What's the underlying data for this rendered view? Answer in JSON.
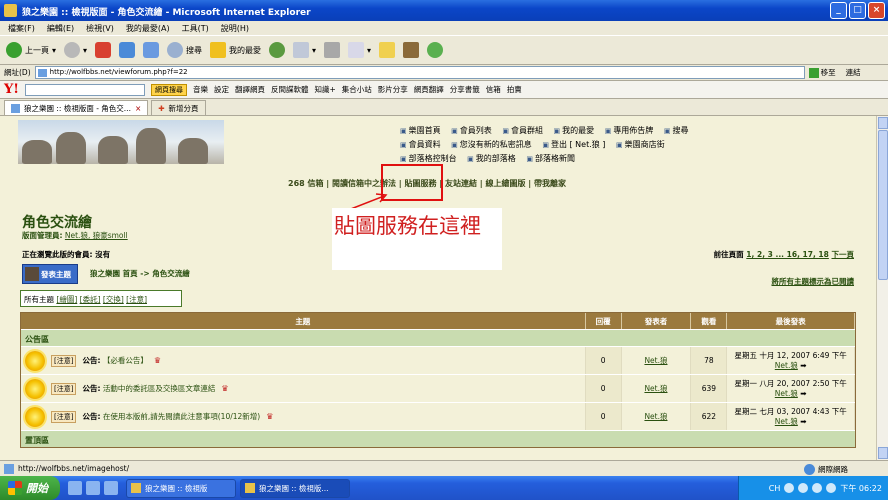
{
  "window": {
    "title": "狼之樂園 :: 檢視版面 - 角色交流繪 - Microsoft Internet Explorer",
    "min": "_",
    "max": "□",
    "close": "×"
  },
  "menu": [
    "檔案(F)",
    "編輯(E)",
    "檢視(V)",
    "我的最愛(A)",
    "工具(T)",
    "說明(H)"
  ],
  "toolbar": {
    "back": "上一頁",
    "search": "搜尋",
    "favorites": "我的最愛"
  },
  "address": {
    "label": "網址(D)",
    "url": "http://wolfbbs.net/viewforum.php?f=22",
    "go": "移至",
    "links": "連結"
  },
  "yahoo": {
    "logo": "Y!",
    "search_btn": "網頁搜尋",
    "items": [
      "音樂",
      "設定",
      "翻譯網頁",
      "反間諜軟體",
      "知識+",
      "集合小站",
      "影片分享",
      "網頁翻譯",
      "分享書籤",
      "信箱",
      "拍賣"
    ]
  },
  "tabs": [
    {
      "label": "狼之樂園 :: 檢視版面 - 角色交..."
    },
    {
      "label": "新增分頁"
    }
  ],
  "site": {
    "toplinks": [
      "樂園首頁",
      "會員列表",
      "會員群組",
      "我的最愛",
      "專用佈告牌",
      "搜尋",
      "會員資料",
      "您沒有新的私密訊息",
      "登出 [ Net.狼 ]",
      "樂園商店街",
      "部落格控制台",
      "我的部落格",
      "部落格新聞"
    ],
    "nav": "268 信箱 | 閱讀信箱中之辦法 | 貼圖服務 | 友站連結 | 線上繪圖版 | 帶我離家",
    "annotation": "貼圖服務在這裡",
    "forum_title": "角色交流繪",
    "moderators_label": "版面管理員:",
    "moderators": "Net.狼, 狼豪smoll",
    "browsing": "正在瀏覽此版的會員: 沒有",
    "pager_label": "前往頁面",
    "pager_pages": "1, 2, 3 ... 16, 17, 18",
    "pager_next": "下一頁",
    "new_topic": "發表主題",
    "crumbs": "狼之樂園 首頁 -> 角色交流繪",
    "mark_read": "將所有主題標示為已閱讀",
    "filter_all": "所有主題",
    "filters": [
      "[繪圖]",
      "[委託]",
      "[交換]",
      "[注意]"
    ]
  },
  "table": {
    "headers": [
      "主題",
      "回覆",
      "發表者",
      "觀看",
      "最後發表"
    ],
    "section1": "公告區",
    "section2": "置頂區",
    "rows": [
      {
        "tag": "[注意]",
        "prefix": "公告:",
        "title": "【必看公告】",
        "replies": "0",
        "author": "Net.狼",
        "views": "78",
        "last_date": "星期五 十月 12, 2007 6:49 下午",
        "last_by": "Net.狼"
      },
      {
        "tag": "[注意]",
        "prefix": "公告:",
        "title": "活動中的委託區及交換區文章連結",
        "replies": "0",
        "author": "Net.狼",
        "views": "639",
        "last_date": "星期一 八月 20, 2007 2:50 下午",
        "last_by": "Net.狼"
      },
      {
        "tag": "[注意]",
        "prefix": "公告:",
        "title": "在使用本版前,請先閱讀此注意事項(10/12新增)",
        "replies": "0",
        "author": "Net.狼",
        "views": "622",
        "last_date": "星期二 七月 03, 2007 4:43 下午",
        "last_by": "Net.狼"
      }
    ]
  },
  "status": {
    "url": "http://wolfbbs.net/imagehost/",
    "zone": "網際網路"
  },
  "taskbar": {
    "start": "開始",
    "tasks": [
      "狼之樂園 :: 檢視版",
      "狼之樂園 :: 檢視版..."
    ],
    "time": "下午 06:22",
    "lang": "CH"
  }
}
